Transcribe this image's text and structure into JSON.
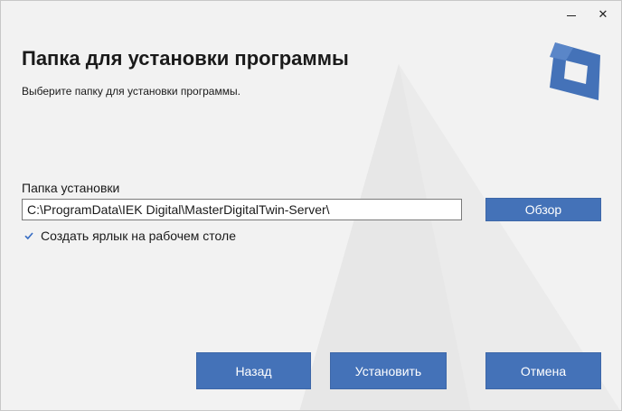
{
  "window": {
    "accent_color": "#4472b8",
    "background_color": "#f2f2f2",
    "titlebar_buttons": {
      "minimize_icon": "minimize-icon",
      "close_glyph": "✕"
    }
  },
  "header": {
    "title": "Папка для установки программы",
    "subtitle": "Выберите папку для установки программы.",
    "logo_icon": "app-logo-icon"
  },
  "folder": {
    "label": "Папка установки",
    "path_value": "C:\\ProgramData\\IEK Digital\\MasterDigitalTwin-Server\\",
    "browse_label": "Обзор"
  },
  "shortcut": {
    "label": "Создать ярлык на рабочем столе",
    "checked": true
  },
  "footer": {
    "back_label": "Назад",
    "install_label": "Установить",
    "cancel_label": "Отмена"
  }
}
